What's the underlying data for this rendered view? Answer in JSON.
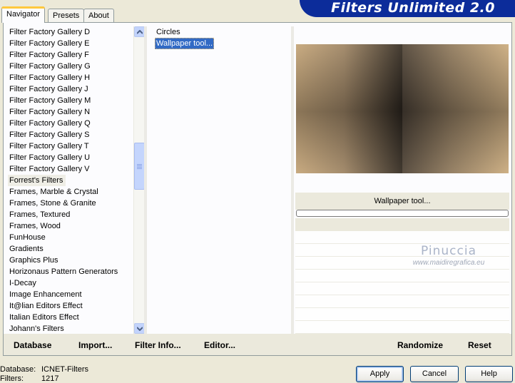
{
  "tabs": [
    "Navigator",
    "Presets",
    "About"
  ],
  "banner_title": "Filters Unlimited 2.0",
  "categories": [
    "Filter Factory Gallery D",
    "Filter Factory Gallery E",
    "Filter Factory Gallery F",
    "Filter Factory Gallery G",
    "Filter Factory Gallery H",
    "Filter Factory Gallery J",
    "Filter Factory Gallery M",
    "Filter Factory Gallery N",
    "Filter Factory Gallery Q",
    "Filter Factory Gallery S",
    "Filter Factory Gallery T",
    "Filter Factory Gallery U",
    "Filter Factory Gallery V",
    "Forrest's Filters",
    "Frames, Marble & Crystal",
    "Frames, Stone & Granite",
    "Frames, Textured",
    "Frames, Wood",
    "FunHouse",
    "Gradients",
    "Graphics Plus",
    "Horizonaus Pattern Generators",
    "I-Decay",
    "Image Enhancement",
    "It@lian Editors Effect",
    "Italian Editors Effect",
    "Johann's Filters"
  ],
  "selected_category": "Forrest's Filters",
  "filters": [
    "Circles",
    "Wallpaper tool..."
  ],
  "selected_filter": "Wallpaper tool...",
  "preview_filter_name": "Wallpaper tool...",
  "watermark": {
    "name": "Pinuccia",
    "site": "www.maidiregrafica.eu"
  },
  "bottom_buttons": {
    "database": "Database",
    "import": "Import...",
    "filter_info": "Filter Info...",
    "editor": "Editor...",
    "randomize": "Randomize",
    "reset": "Reset"
  },
  "status": {
    "database_label": "Database:",
    "database_value": "ICNET-Filters",
    "filters_label": "Filters:",
    "filters_value": "1217"
  },
  "dialog_buttons": {
    "apply": "Apply",
    "cancel": "Cancel",
    "help": "Help"
  },
  "colors": {
    "accent_blue": "#0c2c9a",
    "selection": "#316ac5",
    "preview_light": "#c4a77d",
    "preview_dark": "#25201c"
  },
  "icons": {
    "scroll_up": "chevron-up-icon",
    "scroll_down": "chevron-down-icon"
  }
}
